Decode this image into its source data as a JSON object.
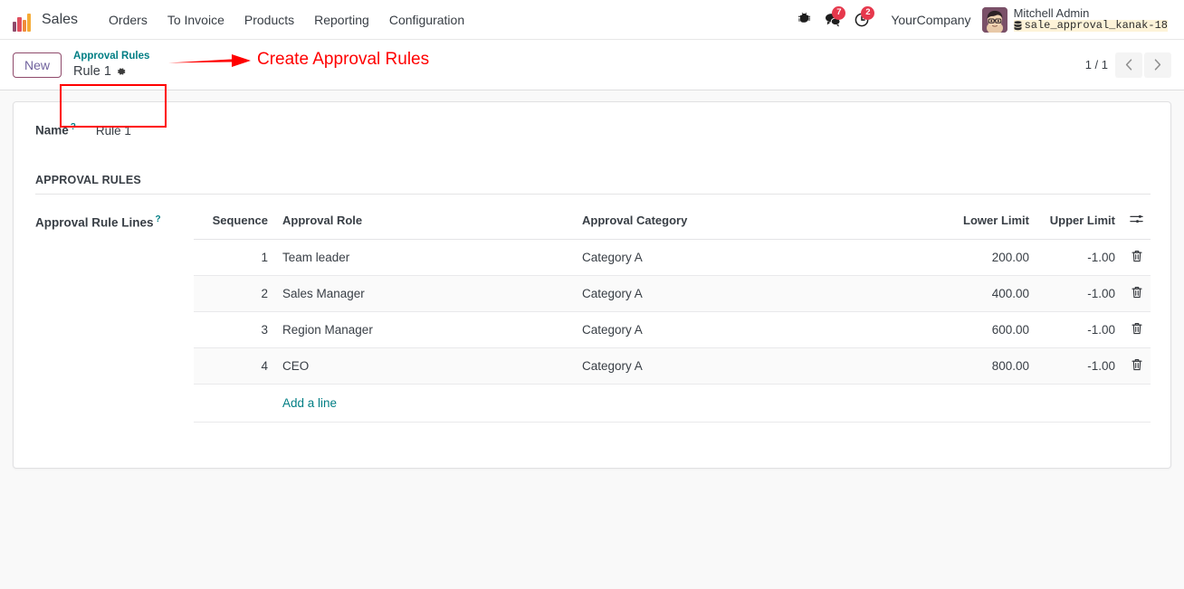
{
  "navbar": {
    "brand_icon": "sales-bar-chart-logo",
    "app_name": "Sales",
    "menu_items": [
      {
        "label": "Orders"
      },
      {
        "label": "To Invoice"
      },
      {
        "label": "Products"
      },
      {
        "label": "Reporting"
      },
      {
        "label": "Configuration"
      }
    ],
    "systray": {
      "debug_icon": "bug-icon",
      "messages_icon": "messages-icon",
      "messages_count": "7",
      "activities_icon": "clock-activities-icon",
      "activities_count": "2",
      "company": "YourCompany",
      "user_name": "Mitchell Admin",
      "database_icon": "database-icon",
      "database": "sale_approval_kanak-18"
    }
  },
  "control_panel": {
    "new_button": "New",
    "breadcrumb_parent": "Approval Rules",
    "breadcrumb_current": "Rule 1",
    "gear_icon": "gear-icon",
    "pager_count": "1 / 1",
    "prev_icon": "chevron-left-icon",
    "next_icon": "chevron-right-icon"
  },
  "annotation": {
    "text": "Create Approval Rules",
    "color": "#ff0000"
  },
  "form": {
    "name_label": "Name",
    "name_tip": "?",
    "name_value": "Rule 1",
    "section_title": "APPROVAL RULES",
    "lines_label": "Approval Rule Lines",
    "lines_tip": "?",
    "columns": {
      "sequence": "Sequence",
      "role": "Approval Role",
      "category": "Approval Category",
      "lower": "Lower Limit",
      "upper": "Upper Limit"
    },
    "optional_columns_icon": "sliders-optional-columns-icon",
    "delete_icon": "trash-icon",
    "rows": [
      {
        "sequence": "1",
        "role": "Team leader",
        "category": "Category A",
        "lower": "200.00",
        "upper": "-1.00"
      },
      {
        "sequence": "2",
        "role": "Sales Manager",
        "category": "Category A",
        "lower": "400.00",
        "upper": "-1.00"
      },
      {
        "sequence": "3",
        "role": "Region Manager",
        "category": "Category A",
        "lower": "600.00",
        "upper": "-1.00"
      },
      {
        "sequence": "4",
        "role": "CEO",
        "category": "Category A",
        "lower": "800.00",
        "upper": "-1.00"
      }
    ],
    "add_line": "Add a line"
  },
  "colors": {
    "brand_teal": "#017e84",
    "accent_purple": "#8f4a6b",
    "badge_red": "#e6384c",
    "annotation_red": "#ff0000"
  }
}
